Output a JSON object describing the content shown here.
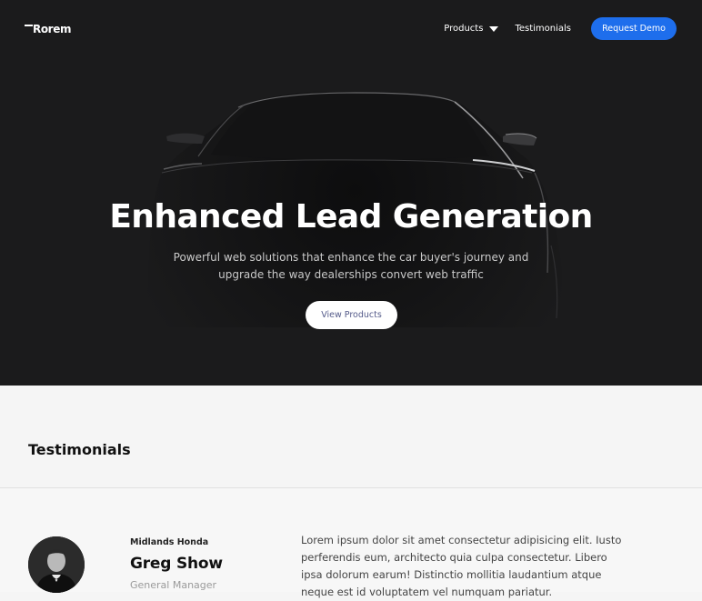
{
  "nav": {
    "logo": "Rorem",
    "products_label": "Products",
    "testimonials_label": "Testimonials",
    "request_demo_label": "Request Demo"
  },
  "hero": {
    "title": "Enhanced Lead Generation",
    "subtitle": "Powerful web solutions that enhance the car buyer's journey and upgrade the way dealerships convert web traffic",
    "cta_label": "View Products"
  },
  "testimonials": {
    "heading": "Testimonials",
    "items": [
      {
        "company": "Midlands Honda",
        "name": "Greg Show",
        "role": "General Manager",
        "quote": "Lorem ipsum dolor sit amet consectetur adipisicing elit. Iusto perferendis eum, architecto quia culpa consectetur. Libero ipsa dolorum earum! Distinctio mollitia laudantium atque neque est id voluptatem vel numquam pariatur."
      }
    ]
  },
  "colors": {
    "hero_bg": "#1b1b1c",
    "accent": "#1e6eec",
    "page_bg": "#f5f5f5"
  },
  "icons": {
    "products_dropdown": "caret-down-icon"
  }
}
